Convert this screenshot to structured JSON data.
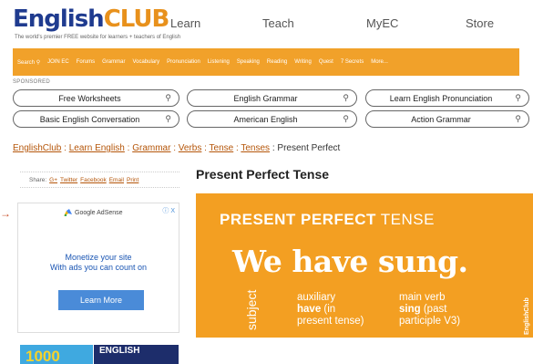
{
  "header": {
    "logo_english": "English",
    "logo_club": "CLUB",
    "tagline": "The world's premier FREE website for learners + teachers of English",
    "top_nav": [
      "Learn",
      "Teach",
      "MyEC",
      "Store"
    ]
  },
  "navbar": {
    "items": [
      "Search",
      "JOIN EC",
      "Forums",
      "Grammar",
      "Vocabulary",
      "Pronunciation",
      "Listening",
      "Speaking",
      "Reading",
      "Writing",
      "Quest",
      "7 Secrets",
      "More..."
    ]
  },
  "sponsored": {
    "label": "SPONSORED",
    "links": [
      "Free Worksheets",
      "English Grammar",
      "Learn English Pronunciation",
      "Basic English Conversation",
      "American English",
      "Action Grammar"
    ]
  },
  "breadcrumb": {
    "items": [
      "EnglishClub",
      "Learn English",
      "Grammar",
      "Verbs",
      "Tense",
      "Tenses"
    ],
    "current": "Present Perfect"
  },
  "share": {
    "label": "Share:",
    "links": [
      "G+",
      "Twitter",
      "Facebook",
      "Email",
      "Print"
    ]
  },
  "page_title": "Present Perfect Tense",
  "ad": {
    "brand": "Google AdSense",
    "line1": "Monetize your site",
    "line2": "With ads you can count on",
    "button": "Learn More",
    "close": "ⓘ X"
  },
  "promo": {
    "left": "1000",
    "right": "ENGLISH"
  },
  "hero": {
    "title_bold": "PRESENT PERFECT",
    "title_light": "TENSE",
    "sentence": "We have sung.",
    "subject": "subject",
    "col1_line1": "auxiliary",
    "col1_bold": "have",
    "col1_rest": "(in",
    "col1_line3": "present tense)",
    "col2_line1": "main verb",
    "col2_bold": "sing",
    "col2_rest": "(past",
    "col2_line3": "participle V3)",
    "brand": "EnglishClub"
  },
  "colors": {
    "orange": "#f39f22",
    "navbar": "#f1a12a",
    "link": "#b5560a",
    "logo_blue": "#1f3b8f"
  }
}
